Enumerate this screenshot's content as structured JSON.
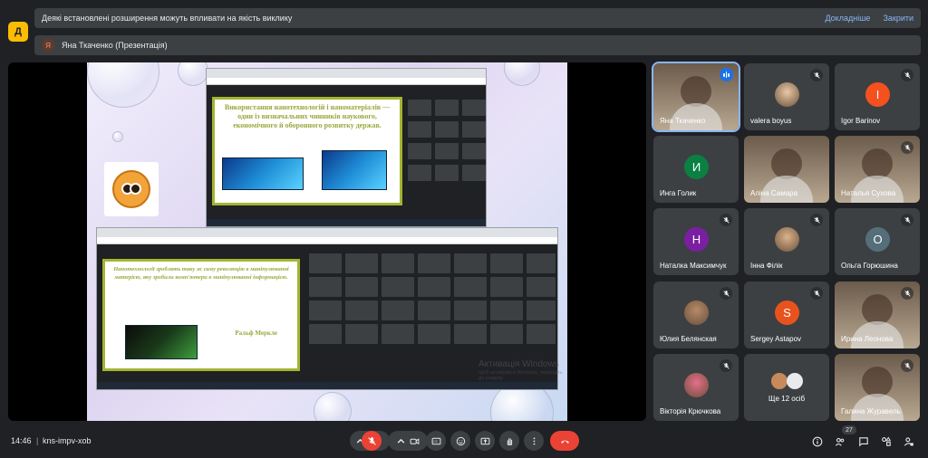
{
  "app_badge": "Д",
  "notice": {
    "message": "Деякі встановлені розширення можуть впливати на якість виклику",
    "details_label": "Докладніше",
    "close_label": "Закрити"
  },
  "presenter": {
    "initial": "Я",
    "label": "Яна Ткаченко (Презентація)"
  },
  "slide": {
    "top_title": "Використання нанотехнологій і наноматеріалів — один із визначальних чинників наукового, економічного й оборонного розвитку держав.",
    "quote": "Нанотехнології зроблять таку ж саму революцію в маніпулюванні матерією, яку зробили комп'ютери в маніпулюванні інформацією.",
    "quote_author": "Ральф Меркле",
    "watermark": "Активація Windows",
    "watermark_sub": "Щоб активувати Windows, перейдіть до розділу"
  },
  "participants": [
    {
      "name": "Яна Ткаченко",
      "type": "video",
      "speaking": true
    },
    {
      "name": "valera boyus",
      "type": "avatar-photo",
      "muted": true,
      "color": "#e9c9a6"
    },
    {
      "name": "Igor Barinov",
      "type": "initial",
      "initial": "I",
      "color": "#f4511e",
      "muted": true
    },
    {
      "name": "Инга Голик",
      "type": "initial",
      "initial": "И",
      "color": "#0b8043",
      "muted": false
    },
    {
      "name": "Аліна Самара",
      "type": "video",
      "muted": false
    },
    {
      "name": "Наталья Сухова",
      "type": "video",
      "muted": true
    },
    {
      "name": "Наталка Максимчук",
      "type": "initial",
      "initial": "Н",
      "color": "#7b1fa2",
      "muted": true
    },
    {
      "name": "Інна Філік",
      "type": "avatar-photo",
      "muted": true,
      "color": "#d9b38c"
    },
    {
      "name": "Ольга Горюшина",
      "type": "initial",
      "initial": "О",
      "color": "#546e7a",
      "muted": true
    },
    {
      "name": "Юлия Белянская",
      "type": "avatar-photo",
      "muted": true,
      "color": "#b58a6a"
    },
    {
      "name": "Sergey Astapov",
      "type": "initial",
      "initial": "S",
      "color": "#e8531d",
      "muted": true
    },
    {
      "name": "Ирина Леонова",
      "type": "video",
      "muted": true
    },
    {
      "name": "Вікторія Крючкова",
      "type": "avatar-photo",
      "muted": true,
      "color": "#e56f8a"
    },
    {
      "name": "Ще 12 осіб",
      "type": "more",
      "muted": false
    },
    {
      "name": "Галина Журавель",
      "type": "video",
      "muted": true
    }
  ],
  "bottom": {
    "time": "14:46",
    "separator": "|",
    "meeting_code": "kns-impv-xob",
    "participant_count": "27"
  },
  "colors": {
    "bg": "#202124",
    "tile": "#3c4043",
    "accent": "#8ab4f8",
    "danger": "#ea4335"
  }
}
